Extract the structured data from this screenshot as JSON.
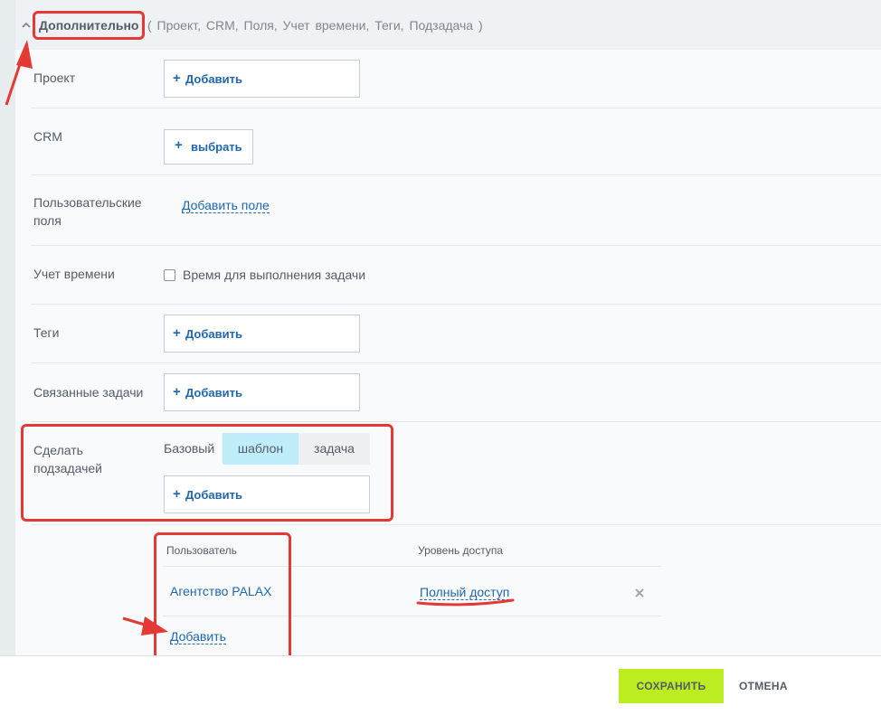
{
  "header": {
    "title": "Дополнительно",
    "subtitle": "( Проект,  CRM,  Поля,  Учет времени,  Теги,  Подзадача )"
  },
  "rows": {
    "project": {
      "label": "Проект",
      "add_label": "Добавить"
    },
    "crm": {
      "label": "CRM",
      "select_label": "выбрать"
    },
    "user_fields": {
      "label_line1": "Пользовательские",
      "label_line2": "поля",
      "link": "Добавить поле"
    },
    "time_tracking": {
      "label": "Учет времени",
      "checkbox_label": "Время для выполнения задачи",
      "checked": false
    },
    "tags": {
      "label": "Теги",
      "add_label": "Добавить"
    },
    "related": {
      "label": "Связанные задачи",
      "add_label": "Добавить"
    },
    "subtask": {
      "label_line1": "Сделать",
      "label_line2": "подзадачей",
      "base_label": "Базовый",
      "segments": [
        "шаблон",
        "задача"
      ],
      "selected": "шаблон",
      "add_label": "Добавить"
    }
  },
  "access_table": {
    "col_user": "Пользователь",
    "col_level": "Уровень доступа",
    "rows": [
      {
        "user": "Агентство PALAX",
        "level": "Полный доступ"
      }
    ],
    "add_label": "Добавить"
  },
  "footer": {
    "save_label": "СОХРАНИТЬ",
    "cancel_label": "ОТМЕНА"
  },
  "colors": {
    "accent": "#bbed21",
    "link": "#2067b0",
    "annotation": "#e53935",
    "segment_active": "#bfeefa"
  },
  "plus_glyph": "+"
}
